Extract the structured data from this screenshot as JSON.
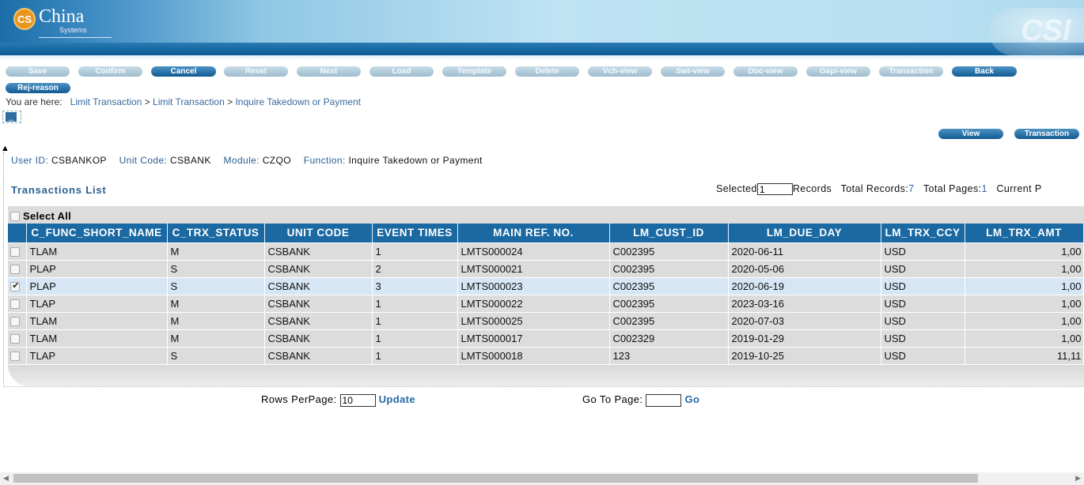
{
  "header": {
    "logo_badge": "CS",
    "logo_name": "China",
    "logo_sub": "Systems",
    "watermark": "CSI"
  },
  "toolbar": {
    "buttons": [
      {
        "label": "Save",
        "state": "disabled"
      },
      {
        "label": "Confirm",
        "state": "disabled"
      },
      {
        "label": "Cancel",
        "state": "active"
      },
      {
        "label": "Reset",
        "state": "disabled"
      },
      {
        "label": "Next",
        "state": "disabled"
      },
      {
        "label": "Load",
        "state": "disabled"
      },
      {
        "label": "Template",
        "state": "disabled"
      },
      {
        "label": "Delete",
        "state": "disabled"
      },
      {
        "label": "Vch-view",
        "state": "disabled"
      },
      {
        "label": "Swt-view",
        "state": "disabled"
      },
      {
        "label": "Doc-view",
        "state": "disabled"
      },
      {
        "label": "Gapi-view",
        "state": "disabled"
      },
      {
        "label": "Transaction",
        "state": "disabled"
      },
      {
        "label": "Back",
        "state": "active"
      },
      {
        "label": "Rej-reason",
        "state": "active"
      }
    ]
  },
  "breadcrumb": {
    "prefix": "You are here:",
    "items": [
      "Limit Transaction",
      "Limit Transaction",
      "Inquire Takedown or Payment"
    ],
    "separator": ">"
  },
  "right_actions": {
    "view": "View",
    "transaction": "Transaction"
  },
  "info": {
    "user_id_label": "User ID:",
    "user_id": "CSBANKOP",
    "unit_code_label": "Unit Code:",
    "unit_code": "CSBANK",
    "module_label": "Module:",
    "module": "CZQO",
    "function_label": "Function:",
    "function": "Inquire Takedown or Payment"
  },
  "list": {
    "title": "Transactions List",
    "selected_label": "Selected",
    "selected_value": "1",
    "records_label": "Records",
    "total_records_label": "Total Records:",
    "total_records": "7",
    "total_pages_label": "Total Pages:",
    "total_pages": "1",
    "current_page_label": "Current P",
    "select_all": "Select All",
    "columns": [
      "C_FUNC_SHORT_NAME",
      "C_TRX_STATUS",
      "UNIT CODE",
      "EVENT TIMES",
      "MAIN REF. NO.",
      "LM_CUST_ID",
      "LM_DUE_DAY",
      "LM_TRX_CCY",
      "LM_TRX_AMT"
    ],
    "rows": [
      {
        "checked": false,
        "cells": [
          "TLAM",
          "M",
          "CSBANK",
          "1",
          "LMTS000024",
          "C002395",
          "2020-06-11",
          "USD",
          "1,00"
        ]
      },
      {
        "checked": false,
        "cells": [
          "PLAP",
          "S",
          "CSBANK",
          "2",
          "LMTS000021",
          "C002395",
          "2020-05-06",
          "USD",
          "1,00"
        ]
      },
      {
        "checked": true,
        "cells": [
          "PLAP",
          "S",
          "CSBANK",
          "3",
          "LMTS000023",
          "C002395",
          "2020-06-19",
          "USD",
          "1,00"
        ]
      },
      {
        "checked": false,
        "cells": [
          "TLAP",
          "M",
          "CSBANK",
          "1",
          "LMTS000022",
          "C002395",
          "2023-03-16",
          "USD",
          "1,00"
        ]
      },
      {
        "checked": false,
        "cells": [
          "TLAM",
          "M",
          "CSBANK",
          "1",
          "LMTS000025",
          "C002395",
          "2020-07-03",
          "USD",
          "1,00"
        ]
      },
      {
        "checked": false,
        "cells": [
          "TLAM",
          "M",
          "CSBANK",
          "1",
          "LMTS000017",
          "C002329",
          "2019-01-29",
          "USD",
          "1,00"
        ]
      },
      {
        "checked": false,
        "cells": [
          "TLAP",
          "S",
          "CSBANK",
          "1",
          "LMTS000018",
          "123",
          "2019-10-25",
          "USD",
          "11,11"
        ]
      }
    ]
  },
  "pagination": {
    "rows_per_page_label": "Rows PerPage:",
    "rows_per_page_value": "10",
    "update": "Update",
    "go_to_page_label": "Go To Page:",
    "go_to_page_value": "",
    "go": "Go"
  },
  "colors": {
    "accent": "#1a69a3",
    "label_blue": "#2a5f92",
    "link_blue": "#2a6aa8"
  }
}
